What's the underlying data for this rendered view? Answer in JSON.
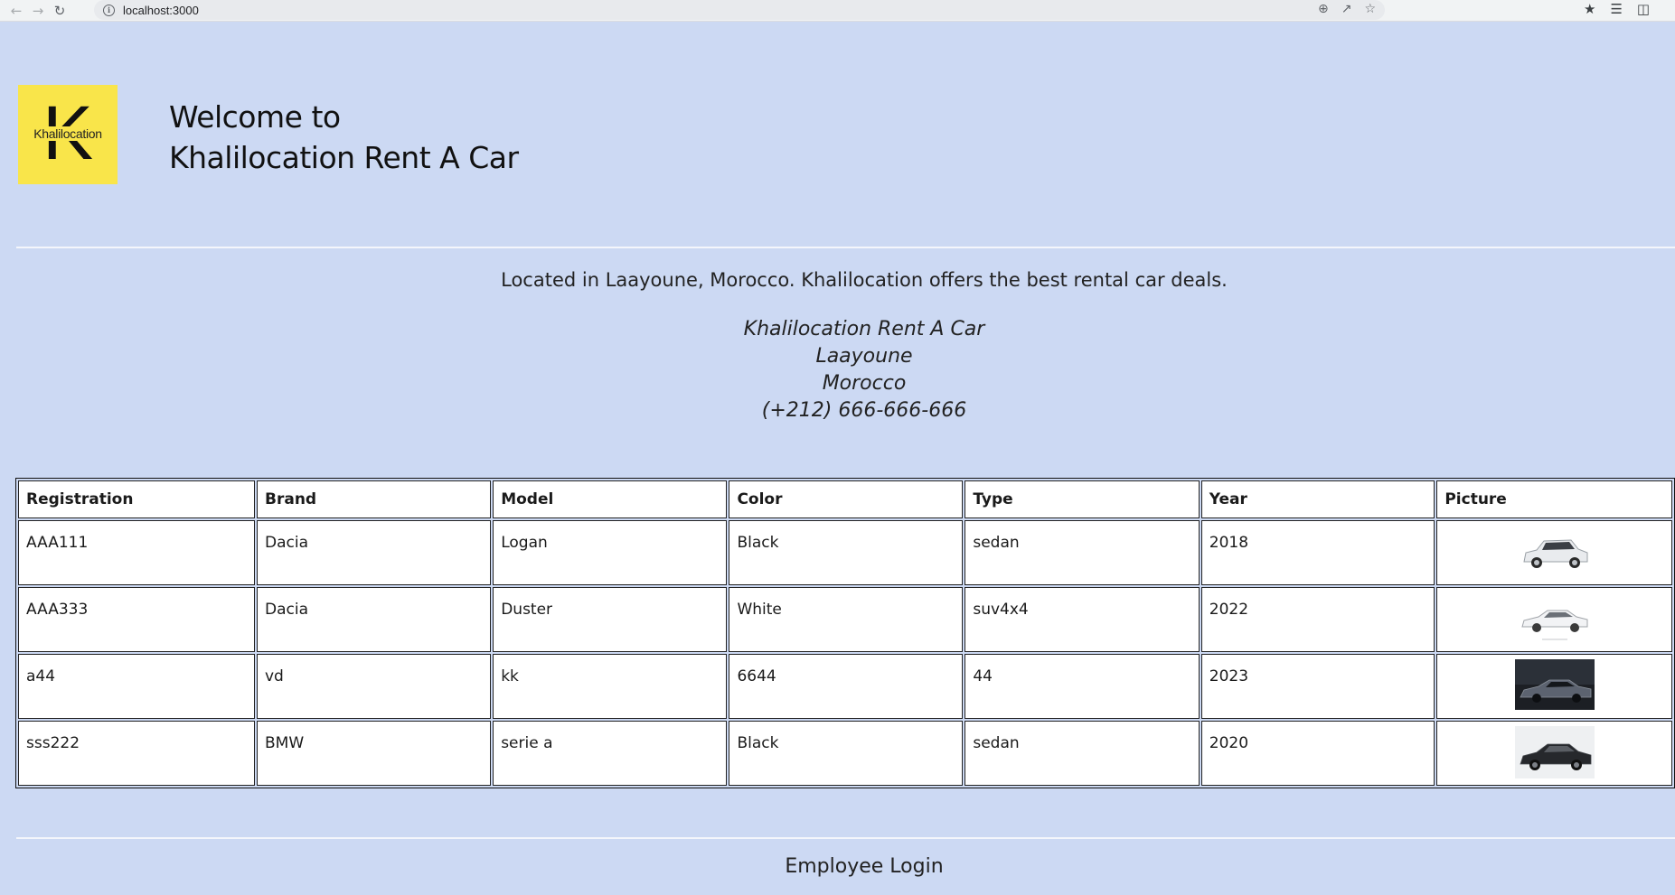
{
  "browser": {
    "url": "localhost:3000"
  },
  "header": {
    "logo_letter": "K",
    "logo_text": "Khalilocation",
    "welcome_line1": "Welcome to",
    "welcome_line2": "Khalilocation Rent A Car"
  },
  "intro": {
    "tagline": "Located in Laayoune, Morocco. Khalilocation offers the best rental car deals.",
    "address": [
      "Khalilocation Rent A Car",
      "Laayoune",
      "Morocco",
      "(+212) 666-666-666"
    ]
  },
  "table": {
    "columns": [
      "Registration",
      "Brand",
      "Model",
      "Color",
      "Type",
      "Year",
      "Picture"
    ],
    "rows": [
      {
        "registration": "AAA111",
        "brand": "Dacia",
        "model": "Logan",
        "color": "Black",
        "type": "sedan",
        "year": "2018",
        "picture": "white-suv"
      },
      {
        "registration": "AAA333",
        "brand": "Dacia",
        "model": "Duster",
        "color": "White",
        "type": "suv4x4",
        "year": "2022",
        "picture": "white-sedan"
      },
      {
        "registration": "a44",
        "brand": "vd",
        "model": "kk",
        "color": "6644",
        "type": "44",
        "year": "2023",
        "picture": "dark-sedan-photo"
      },
      {
        "registration": "sss222",
        "brand": "BMW",
        "model": "serie a",
        "color": "Black",
        "type": "sedan",
        "year": "2020",
        "picture": "black-sedan"
      }
    ]
  },
  "footer": {
    "employee_login": "Employee Login"
  },
  "colors": {
    "page_background": "#ccd9f3",
    "logo_background": "#f9e54a"
  }
}
